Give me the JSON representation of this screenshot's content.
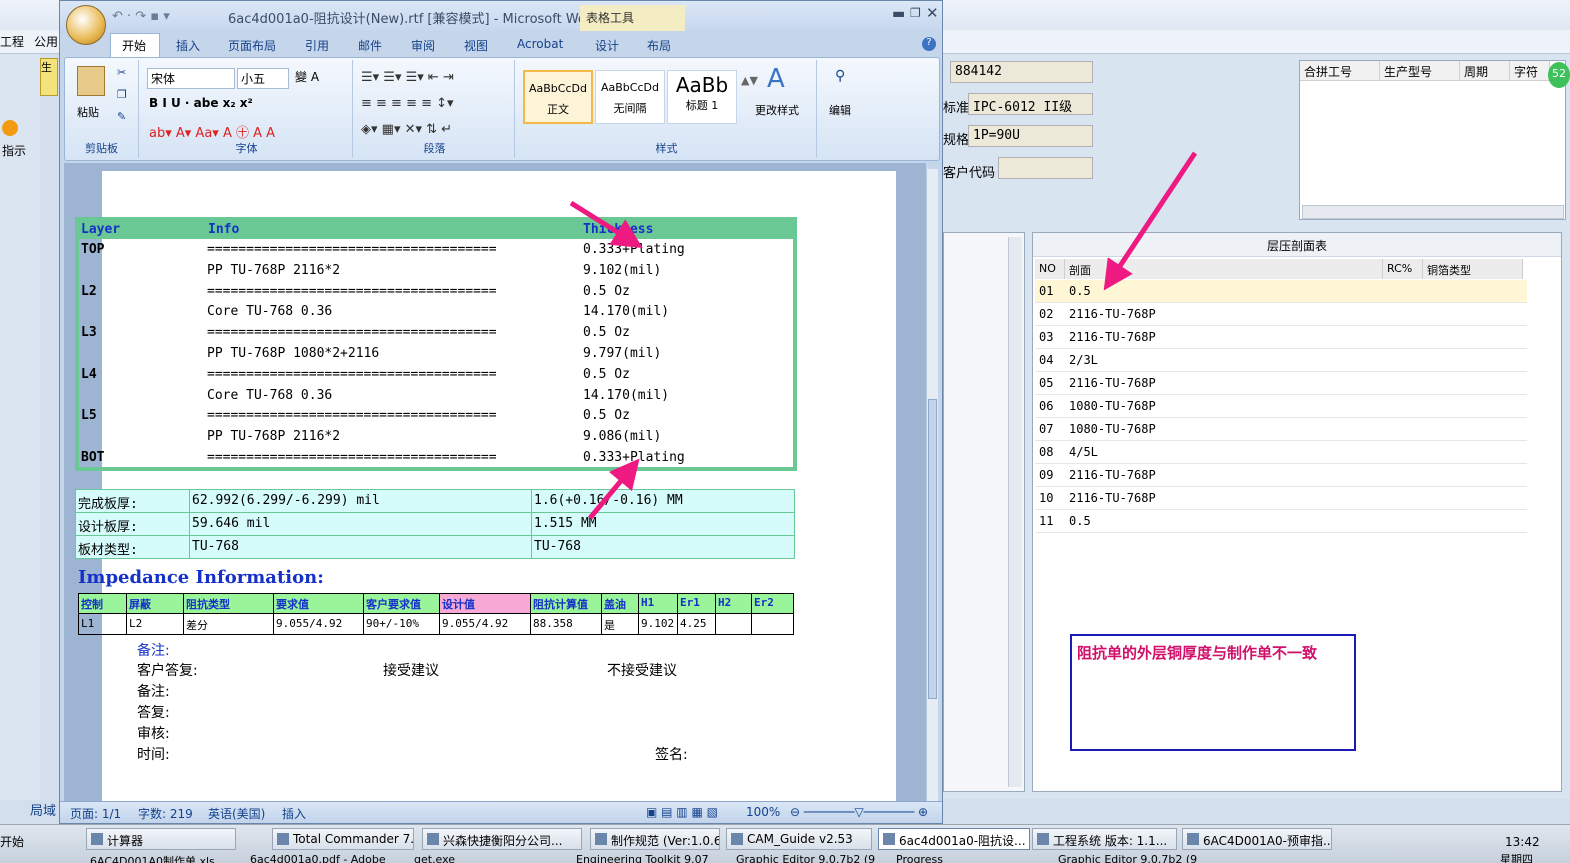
{
  "background_app": {
    "menu_items": [
      "工程",
      "公用"
    ],
    "fields": [
      {
        "label": "",
        "value": "884142"
      },
      {
        "label": "标准",
        "value": "IPC-6012 II级"
      },
      {
        "label": "规格",
        "value": "1P=90U"
      },
      {
        "label": "客户代码",
        "value": ""
      }
    ],
    "top_right_grid_headers": [
      "合拼工号",
      "生产型号",
      "周期",
      "字符"
    ],
    "stackup": {
      "caption": "层压剖面表",
      "columns": [
        "NO",
        "剖面",
        "RC%",
        "铜箔类型"
      ],
      "rows": [
        {
          "no": "01",
          "section": "0.5"
        },
        {
          "no": "02",
          "section": "2116-TU-768P"
        },
        {
          "no": "03",
          "section": "2116-TU-768P"
        },
        {
          "no": "04",
          "section": "2/3L"
        },
        {
          "no": "05",
          "section": "2116-TU-768P"
        },
        {
          "no": "06",
          "section": "1080-TU-768P"
        },
        {
          "no": "07",
          "section": "1080-TU-768P"
        },
        {
          "no": "08",
          "section": "4/5L"
        },
        {
          "no": "09",
          "section": "2116-TU-768P"
        },
        {
          "no": "10",
          "section": "2116-TU-768P"
        },
        {
          "no": "11",
          "section": "0.5"
        }
      ]
    },
    "note": "阻抗单的外层铜厚度与制作单不一致",
    "left_labels": [
      "指示",
      "生",
      "6A",
      "局域"
    ],
    "badge": "52"
  },
  "word": {
    "title": "6ac4d001a0-阻抗设计(New).rtf [兼容模式] - Microsoft Wo...",
    "context_tab": "表格工具",
    "tabs": [
      "开始",
      "插入",
      "页面布局",
      "引用",
      "邮件",
      "审阅",
      "视图",
      "Acrobat",
      "设计",
      "布局"
    ],
    "ribbon": {
      "clipboard": {
        "paste": "粘贴",
        "label": "剪贴板"
      },
      "font": {
        "name": "宋体",
        "size": "小五",
        "label": "字体"
      },
      "paragraph": {
        "label": "段落"
      },
      "styles": {
        "label": "样式",
        "items": [
          {
            "preview": "AaBbCcDd",
            "name": "正文"
          },
          {
            "preview": "AaBbCcDd",
            "name": "无间隔"
          },
          {
            "preview": "AaBb",
            "name": "标题 1"
          }
        ],
        "change": "更改样式"
      },
      "edit": {
        "label": "编辑"
      }
    },
    "document": {
      "layer_table": {
        "headers": [
          "Layer",
          "Info",
          "Thickness"
        ],
        "rows": [
          {
            "layer": "TOP",
            "info": "=====================================",
            "thickness": "0.333+Plating"
          },
          {
            "layer": "",
            "info": "PP    TU-768P    2116*2",
            "thickness": "9.102(mil)"
          },
          {
            "layer": "L2",
            "info": "=====================================",
            "thickness": "0.5 Oz"
          },
          {
            "layer": "",
            "info": "Core    TU-768    0.36",
            "thickness": "14.170(mil)"
          },
          {
            "layer": "L3",
            "info": "=====================================",
            "thickness": "0.5 Oz"
          },
          {
            "layer": "",
            "info": "PP    TU-768P    1080*2+2116",
            "thickness": "9.797(mil)"
          },
          {
            "layer": "L4",
            "info": "=====================================",
            "thickness": "0.5 Oz"
          },
          {
            "layer": "",
            "info": "Core    TU-768    0.36",
            "thickness": "14.170(mil)"
          },
          {
            "layer": "L5",
            "info": "=====================================",
            "thickness": "0.5 Oz"
          },
          {
            "layer": "",
            "info": "PP    TU-768P    2116*2",
            "thickness": "9.086(mil)"
          },
          {
            "layer": "BOT",
            "info": "=====================================",
            "thickness": "0.333+Plating"
          }
        ]
      },
      "thickness_table": [
        {
          "label": "完成板厚:",
          "mil": "62.992(6.299/-6.299) mil",
          "mm": "1.6(+0.16/-0.16) MM"
        },
        {
          "label": "设计板厚:",
          "mil": "59.646 mil",
          "mm": "1.515 MM"
        },
        {
          "label": "板材类型:",
          "mil": "TU-768",
          "mm": "TU-768"
        }
      ],
      "impedance_title": "Impedance Information:",
      "impedance_headers": [
        "控制",
        "屏蔽",
        "阻抗类型",
        "要求值",
        "客户要求值",
        "设计值",
        "阻抗计算值",
        "盖油",
        "H1",
        "Er1",
        "H2",
        "Er2"
      ],
      "impedance_row": [
        "L1",
        "L2",
        "差分",
        "9.055/4.92",
        "90+/-10%",
        "9.055/4.92",
        "88.358",
        "是",
        "9.102",
        "4.25",
        "",
        ""
      ],
      "remarks": {
        "remark1": "备注:",
        "customer_reply": "客户答复:",
        "accept": "接受建议",
        "reject": "不接受建议",
        "remark2": "备注:",
        "reply": "答复:",
        "review": "审核:",
        "time": "时间:",
        "sign": "签名:"
      }
    },
    "status": {
      "page": "页面: 1/1",
      "words": "字数: 219",
      "lang": "英语(美国)",
      "mode": "插入",
      "zoom": "100%"
    }
  },
  "taskbar": {
    "start": "开始",
    "row1": [
      "计算器",
      "Total Commander 7.0 ...",
      "兴森快捷衡阳分公司...",
      "制作规范 (Ver:1.0.6)",
      "CAM_Guide v2.53",
      "6ac4d001a0-阻抗设...",
      "工程系统  版本: 1.1...",
      "6AC4D001A0-预审指..."
    ],
    "row2": [
      "6AC4D001A0制作单.xls",
      "6ac4d001a0.pdf - Adobe",
      "get.exe",
      "Engineering Toolkit 9.07",
      "Graphic Editor 9.0.7b2 (9",
      "Progress",
      "Graphic Editor 9.0.7b2 (9"
    ],
    "clock": "13:42",
    "day": "星期四"
  },
  "colors": {
    "arrow": "#ee1a82",
    "green_border": "#6ac895",
    "blue_text": "#1531c9",
    "note_border": "#1a1ab5"
  }
}
